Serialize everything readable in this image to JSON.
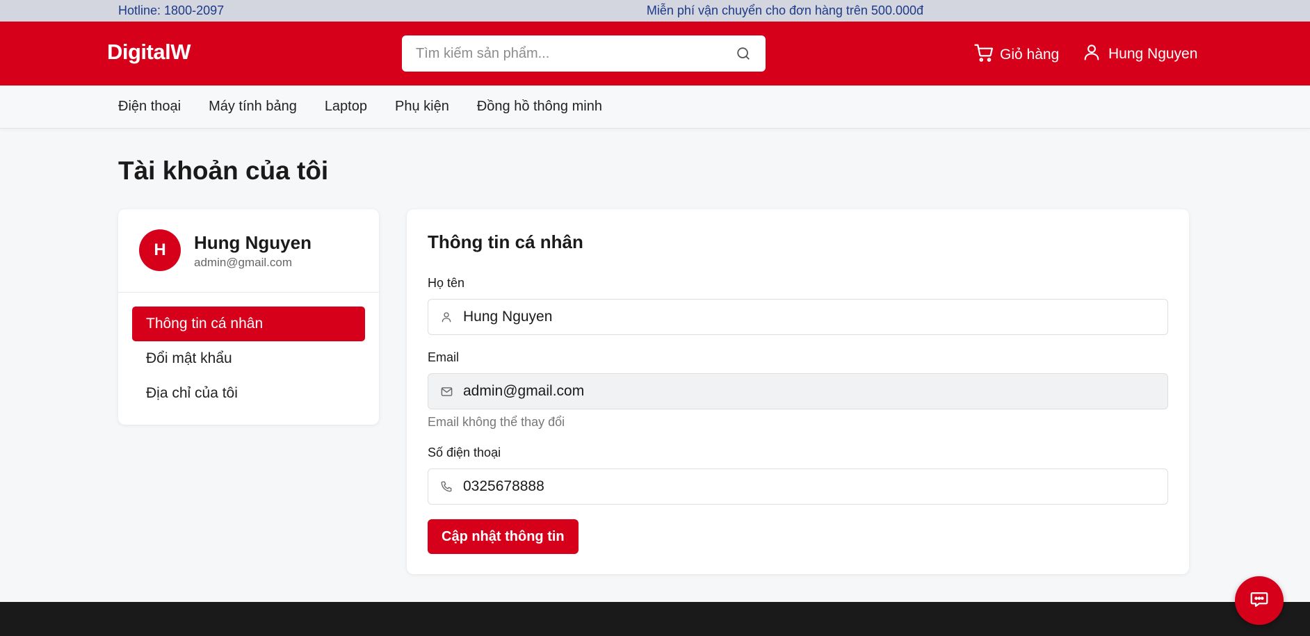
{
  "topbar": {
    "hotline": "Hotline: 1800-2097",
    "shipping_notice": "Miễn phí vận chuyển cho đơn hàng trên 500.000đ"
  },
  "header": {
    "logo": "DigitalW",
    "search_placeholder": "Tìm kiếm sản phẩm...",
    "cart_label": "Giỏ hàng",
    "user_label": "Hung Nguyen"
  },
  "nav": {
    "items": [
      "Điện thoại",
      "Máy tính bảng",
      "Laptop",
      "Phụ kiện",
      "Đồng hồ thông minh"
    ]
  },
  "page": {
    "title": "Tài khoản của tôi"
  },
  "sidebar": {
    "avatar_initial": "H",
    "name": "Hung Nguyen",
    "email": "admin@gmail.com",
    "menu": [
      {
        "label": "Thông tin cá nhân",
        "active": true
      },
      {
        "label": "Đổi mật khẩu",
        "active": false
      },
      {
        "label": "Địa chỉ của tôi",
        "active": false
      }
    ]
  },
  "form": {
    "title": "Thông tin cá nhân",
    "name_label": "Họ tên",
    "name_value": "Hung Nguyen",
    "email_label": "Email",
    "email_value": "admin@gmail.com",
    "email_hint": "Email không thể thay đổi",
    "phone_label": "Số điện thoại",
    "phone_value": "0325678888",
    "submit_label": "Cập nhật thông tin"
  },
  "colors": {
    "brand_red": "#d7001a",
    "topbar_bg": "#d3d6de",
    "footer_bg": "#1a1a1a"
  },
  "icons": {
    "search": "search-icon",
    "cart": "cart-icon",
    "user": "user-icon",
    "email": "mail-icon",
    "phone": "phone-icon",
    "chat": "chat-icon"
  }
}
